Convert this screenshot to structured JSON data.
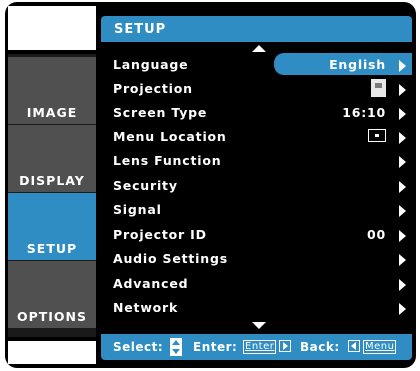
{
  "tabs": [
    {
      "label": "IMAGE"
    },
    {
      "label": "DISPLAY"
    },
    {
      "label": "SETUP"
    },
    {
      "label": "OPTIONS"
    }
  ],
  "active_tab": "SETUP",
  "header": {
    "title": "SETUP"
  },
  "menu": [
    {
      "label": "Language",
      "value": "English"
    },
    {
      "label": "Projection",
      "value": ""
    },
    {
      "label": "Screen Type",
      "value": "16:10"
    },
    {
      "label": "Menu Location",
      "value": ""
    },
    {
      "label": "Lens Function",
      "value": ""
    },
    {
      "label": "Security",
      "value": ""
    },
    {
      "label": "Signal",
      "value": ""
    },
    {
      "label": "Projector ID",
      "value": "00"
    },
    {
      "label": "Audio Settings",
      "value": ""
    },
    {
      "label": "Advanced",
      "value": ""
    },
    {
      "label": "Network",
      "value": ""
    }
  ],
  "footer": {
    "select_label": "Select:",
    "enter_label": "Enter:",
    "enter_key": "Enter",
    "back_label": "Back:",
    "menu_key": "Menu"
  },
  "colors": {
    "accent": "#2f8dc4",
    "panel": "#000000",
    "tab": "#505050"
  }
}
